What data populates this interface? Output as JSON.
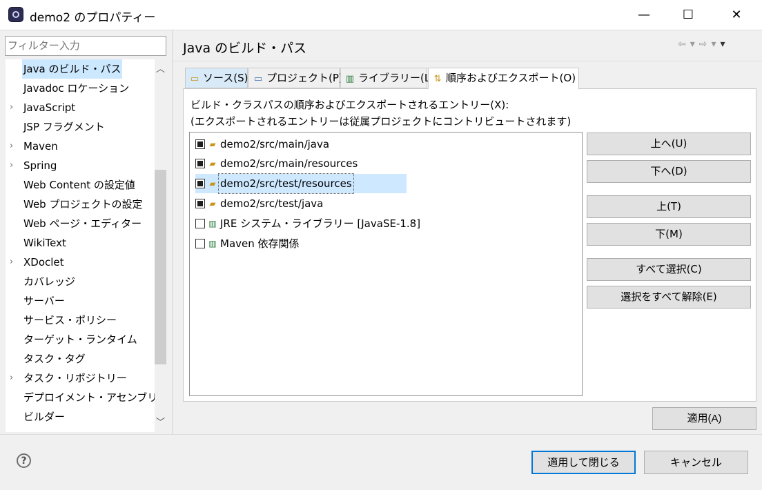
{
  "window": {
    "title": "demo2 のプロパティー"
  },
  "filter": {
    "placeholder": "フィルター入力"
  },
  "tree": {
    "items": [
      {
        "label": "Java のビルド・パス",
        "expandable": false,
        "selected": true
      },
      {
        "label": "Javadoc ロケーション",
        "expandable": false
      },
      {
        "label": "JavaScript",
        "expandable": true
      },
      {
        "label": "JSP フラグメント",
        "expandable": false
      },
      {
        "label": "Maven",
        "expandable": true
      },
      {
        "label": "Spring",
        "expandable": true
      },
      {
        "label": "Web Content の設定値",
        "expandable": false
      },
      {
        "label": "Web プロジェクトの設定",
        "expandable": false
      },
      {
        "label": "Web ページ・エディター",
        "expandable": false
      },
      {
        "label": "WikiText",
        "expandable": false
      },
      {
        "label": "XDoclet",
        "expandable": true
      },
      {
        "label": "カバレッジ",
        "expandable": false
      },
      {
        "label": "サーバー",
        "expandable": false
      },
      {
        "label": "サービス・ポリシー",
        "expandable": false
      },
      {
        "label": "ターゲット・ランタイム",
        "expandable": false
      },
      {
        "label": "タスク・タグ",
        "expandable": false
      },
      {
        "label": "タスク・リポジトリー",
        "expandable": true
      },
      {
        "label": "デプロイメント・アセンブリー",
        "expandable": false
      },
      {
        "label": "ビルダー",
        "expandable": false
      }
    ]
  },
  "page": {
    "title": "Java のビルド・パス"
  },
  "tabs": [
    {
      "label": "ソース(S)",
      "icon": "source-folder-icon"
    },
    {
      "label": "プロジェクト(P)",
      "icon": "project-icon"
    },
    {
      "label": "ライブラリー(L)",
      "icon": "library-icon"
    },
    {
      "label": "順序およびエクスポート(O)",
      "icon": "order-export-icon"
    }
  ],
  "content": {
    "desc1": "ビルド・クラスパスの順序およびエクスポートされるエントリー(X):",
    "desc2": "(エクスポートされるエントリーは従属プロジェクトにコントリビュートされます)",
    "entries": [
      {
        "label": "demo2/src/main/java",
        "checked": true,
        "icon": "package-folder-icon"
      },
      {
        "label": "demo2/src/main/resources",
        "checked": true,
        "icon": "package-folder-icon"
      },
      {
        "label": "demo2/src/test/resources",
        "checked": true,
        "icon": "package-folder-icon",
        "selected": true
      },
      {
        "label": "demo2/src/test/java",
        "checked": true,
        "icon": "package-folder-icon"
      },
      {
        "label": "JRE システム・ライブラリー [JavaSE-1.8]",
        "checked": false,
        "icon": "library-icon"
      },
      {
        "label": "Maven 依存関係",
        "checked": false,
        "icon": "library-icon"
      }
    ]
  },
  "buttons": {
    "up": "上へ(U)",
    "down": "下へ(D)",
    "top": "上(T)",
    "bottom": "下(M)",
    "select_all": "すべて選択(C)",
    "deselect_all": "選択をすべて解除(E)",
    "apply": "適用(A)",
    "apply_close": "適用して閉じる",
    "cancel": "キャンセル"
  },
  "colors": {
    "selection": "#cce8ff",
    "default_button_border": "#0078d7"
  }
}
